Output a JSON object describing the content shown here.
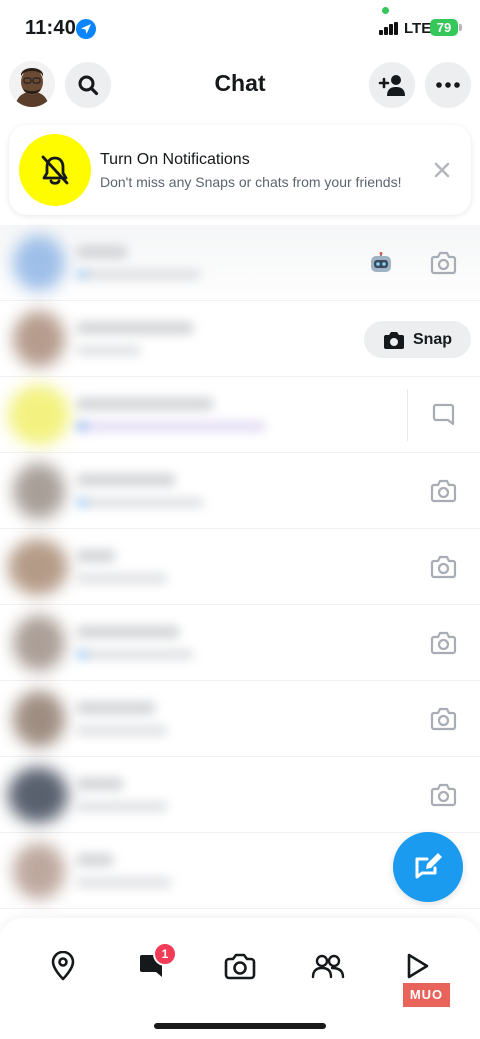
{
  "status_bar": {
    "time": "11:40",
    "network": "LTE",
    "battery": "79"
  },
  "header": {
    "title": "Chat"
  },
  "notification": {
    "title": "Turn On Notifications",
    "subtitle": "Don't miss any Snaps or chats from your friends!"
  },
  "chat_list": {
    "rows": [
      {
        "action": "camera",
        "extra": "robot-emoji"
      },
      {
        "action": "snap",
        "snap_label": "Snap"
      },
      {
        "action": "chat"
      },
      {
        "action": "camera"
      },
      {
        "action": "camera"
      },
      {
        "action": "camera"
      },
      {
        "action": "camera"
      },
      {
        "action": "camera"
      },
      {
        "action": "none"
      }
    ]
  },
  "bottom_nav": {
    "items": [
      "map-icon",
      "chat-icon",
      "camera-icon",
      "friends-icon",
      "spotlight-icon"
    ],
    "chat_badge": "1"
  },
  "watermark": "MUO",
  "colors": {
    "snapchat_yellow": "#fffc00",
    "accent_blue": "#1a9bf0",
    "badge_red": "#f23c57",
    "battery_green": "#35c759"
  }
}
